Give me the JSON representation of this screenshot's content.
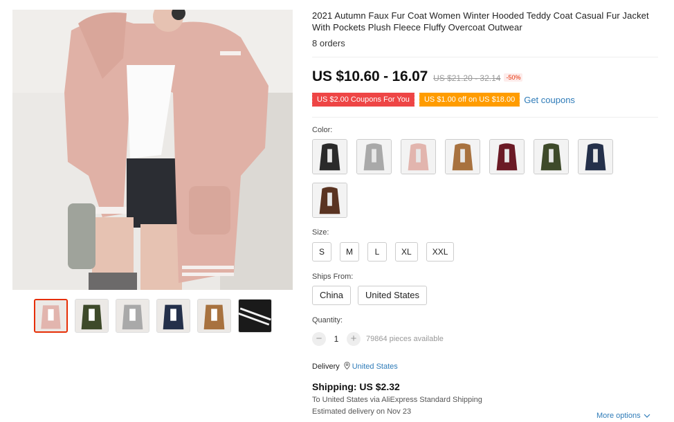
{
  "product": {
    "title": "2021 Autumn Faux Fur Coat Women Winter Hooded Teddy Coat Casual Fur Jacket With Pockets Plush Fleece Fluffy Overcoat Outwear",
    "orders": "8 orders",
    "price": "US $10.60 - 16.07",
    "old_price": "US $21.20 - 32.14",
    "discount": "-50%"
  },
  "coupons": {
    "coupon1": "US $2.00 Coupons For You",
    "coupon2": "US $1.00 off on US $18.00",
    "get_coupons": "Get coupons"
  },
  "color": {
    "label": "Color:",
    "options": [
      {
        "name": "black-coat",
        "fill": "#2a2a2a"
      },
      {
        "name": "gray-coat",
        "fill": "#a9a9a9"
      },
      {
        "name": "pink-coat",
        "fill": "#e2b5ae"
      },
      {
        "name": "camel-coat",
        "fill": "#a8723f"
      },
      {
        "name": "wine-coat",
        "fill": "#6b1a25"
      },
      {
        "name": "army-green-coat",
        "fill": "#3e4a2a"
      },
      {
        "name": "navy-coat",
        "fill": "#24304a"
      },
      {
        "name": "brown-coat",
        "fill": "#5a3422"
      }
    ]
  },
  "size": {
    "label": "Size:",
    "options": [
      "S",
      "M",
      "L",
      "XL",
      "XXL"
    ]
  },
  "ships_from": {
    "label": "Ships From:",
    "options": [
      "China",
      "United States"
    ]
  },
  "quantity": {
    "label": "Quantity:",
    "minus": "−",
    "value": "1",
    "plus": "+",
    "available": "79864 pieces available"
  },
  "delivery": {
    "label": "Delivery",
    "location": "United States",
    "icon": "location-pin-icon"
  },
  "shipping": {
    "title": "Shipping: US $2.32",
    "detail": "To United States via AliExpress Standard Shipping",
    "estimate": "Estimated delivery on Nov 23",
    "more_options": "More options"
  },
  "gallery": {
    "thumbnails": [
      {
        "name": "pink",
        "fill": "#e2b5ae"
      },
      {
        "name": "green",
        "fill": "#3e4a2a"
      },
      {
        "name": "gray",
        "fill": "#a9a9a9"
      },
      {
        "name": "navy",
        "fill": "#24304a"
      },
      {
        "name": "camel",
        "fill": "#a8723f"
      },
      {
        "name": "stripe-detail",
        "fill": "#1a1a1a"
      }
    ]
  }
}
